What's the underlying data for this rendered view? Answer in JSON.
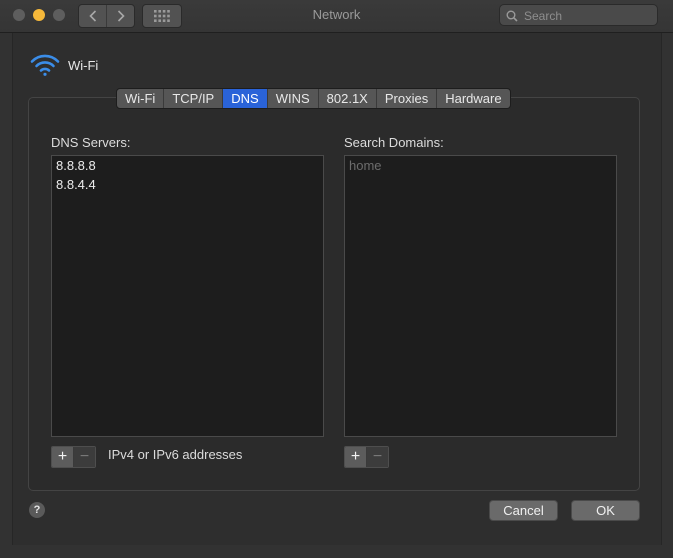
{
  "window": {
    "title": "Network"
  },
  "search": {
    "placeholder": "Search"
  },
  "service": {
    "name": "Wi-Fi"
  },
  "tabs": [
    {
      "label": "Wi-Fi",
      "active": false
    },
    {
      "label": "TCP/IP",
      "active": false
    },
    {
      "label": "DNS",
      "active": true
    },
    {
      "label": "WINS",
      "active": false
    },
    {
      "label": "802.1X",
      "active": false
    },
    {
      "label": "Proxies",
      "active": false
    },
    {
      "label": "Hardware",
      "active": false
    }
  ],
  "dns": {
    "label": "DNS Servers:",
    "servers": [
      "8.8.8.8",
      "8.8.4.4"
    ],
    "hint": "IPv4 or IPv6 addresses"
  },
  "search_domains": {
    "label": "Search Domains:",
    "placeholder": "home"
  },
  "controls": {
    "plus": "+",
    "minus": "−"
  },
  "buttons": {
    "help": "?",
    "cancel": "Cancel",
    "ok": "OK"
  },
  "colors": {
    "accent": "#2a63d8",
    "minimize": "#f5b83a",
    "wifi_icon": "#3b8de8"
  }
}
